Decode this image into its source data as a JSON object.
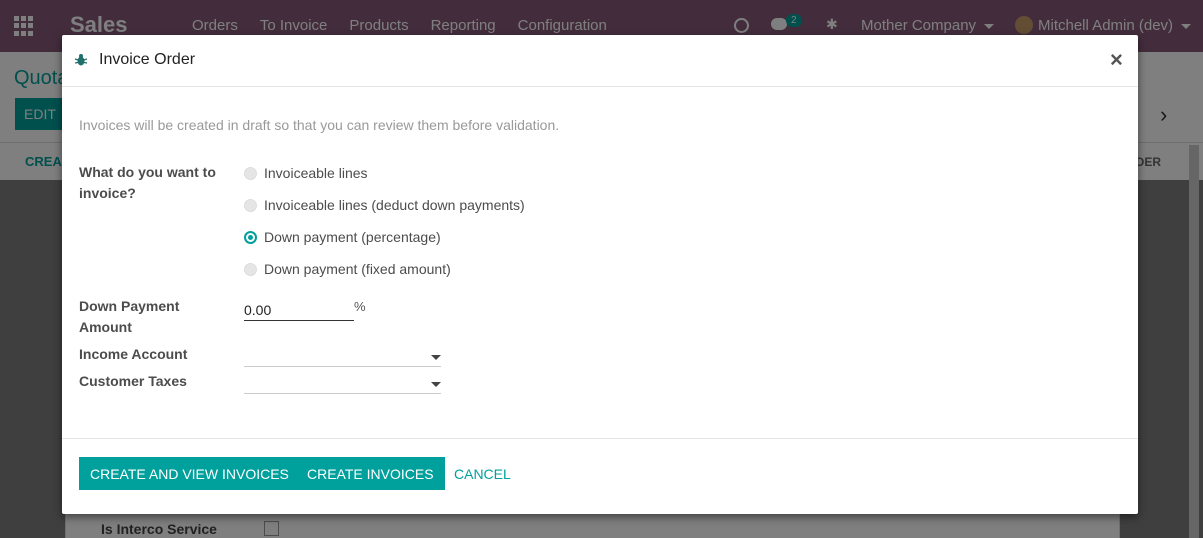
{
  "app": {
    "brand": "Sales",
    "menu": [
      "Orders",
      "To Invoice",
      "Products",
      "Reporting",
      "Configuration"
    ],
    "chat_count": "2",
    "company": "Mother Company",
    "user": "Mitchell Admin (dev)"
  },
  "background": {
    "breadcrumb": "Quota",
    "edit_label": "EDIT",
    "create_link": "CREA",
    "order_link": "RDER",
    "pager_next": "›",
    "interco_label": "Is Interco Service"
  },
  "dialog": {
    "title": "Invoice Order",
    "close": "×",
    "info": "Invoices will be created in draft so that you can review them before validation.",
    "question_label": "What do you want to invoice?",
    "options": [
      {
        "label": "Invoiceable lines",
        "checked": false
      },
      {
        "label": "Invoiceable lines (deduct down payments)",
        "checked": false
      },
      {
        "label": "Down payment (percentage)",
        "checked": true
      },
      {
        "label": "Down payment (fixed amount)",
        "checked": false
      }
    ],
    "amount_label": "Down Payment Amount",
    "amount_value": "0.00",
    "amount_unit": "%",
    "income_account_label": "Income Account",
    "income_account_value": "",
    "customer_taxes_label": "Customer Taxes",
    "customer_taxes_value": ""
  },
  "footer": {
    "create_view_label": "Create and View Invoices",
    "create_label": "Create Invoices",
    "cancel_label": "Cancel"
  },
  "colors": {
    "brand": "#875a7b",
    "accent": "#00a09d"
  }
}
